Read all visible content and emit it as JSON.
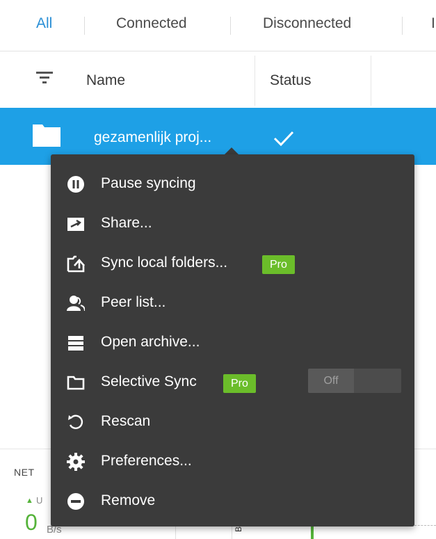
{
  "tabs": [
    {
      "label": "All",
      "active": true
    },
    {
      "label": "Connected",
      "active": false
    },
    {
      "label": "Disconnected",
      "active": false
    },
    {
      "label": "I",
      "active": false
    }
  ],
  "columns": {
    "name": "Name",
    "status": "Status"
  },
  "selected_row": {
    "name": "gezamenlijk proj...",
    "status_icon": "check-icon"
  },
  "menu": {
    "items": [
      {
        "label": "Pause syncing",
        "icon": "pause-icon"
      },
      {
        "label": "Share...",
        "icon": "share-icon"
      },
      {
        "label": "Sync local folders...",
        "icon": "upload-folder-icon",
        "badge": "Pro"
      },
      {
        "label": "Peer list...",
        "icon": "peers-icon"
      },
      {
        "label": "Open archive...",
        "icon": "archive-icon"
      },
      {
        "label": "Selective Sync",
        "icon": "folder-outline-icon",
        "badge": "Pro",
        "toggle": "Off"
      },
      {
        "label": "Rescan",
        "icon": "rescan-icon"
      },
      {
        "label": "Preferences...",
        "icon": "gear-icon"
      },
      {
        "label": "Remove",
        "icon": "remove-icon"
      }
    ]
  },
  "bottom": {
    "section_label": "NET",
    "up_label": "U",
    "speed_value": "0",
    "speed_unit": "B/s",
    "rotated_text": "B"
  },
  "colors": {
    "accent": "#1ea0e6",
    "tab_active": "#2a8fd6",
    "menu_bg": "#3b3b3b",
    "pro_badge": "#6bbd2a",
    "graph_green": "#55b33a"
  }
}
